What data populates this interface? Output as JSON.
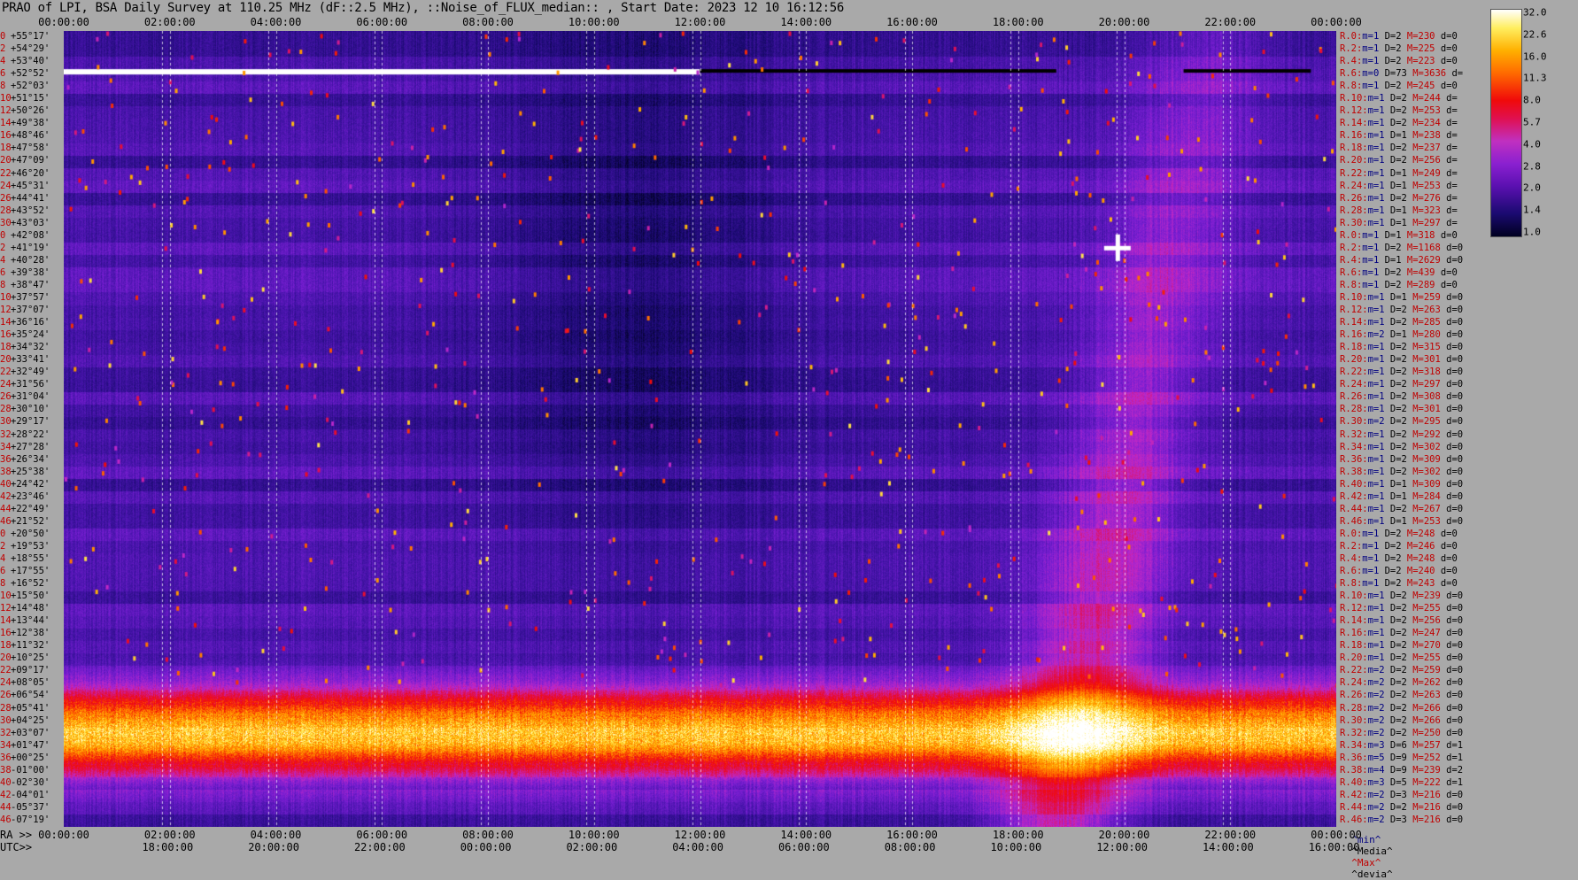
{
  "title": "PRAO of LPI, BSA Daily Survey at 110.25 MHz (dF::2.5 MHz), ::Noise_of_FLUX_median:: , Start Date: 2023 12 10 16:12:56",
  "top_axis": [
    "00:00:00",
    "02:00:00",
    "04:00:00",
    "06:00:00",
    "08:00:00",
    "10:00:00",
    "12:00:00",
    "14:00:00",
    "16:00:00",
    "18:00:00",
    "20:00:00",
    "22:00:00",
    "00:00:00"
  ],
  "ra_axis": {
    "prefix": "RA >>",
    "ticks": [
      "00:00:00",
      "02:00:00",
      "04:00:00",
      "06:00:00",
      "08:00:00",
      "10:00:00",
      "12:00:00",
      "14:00:00",
      "16:00:00",
      "18:00:00",
      "20:00:00",
      "22:00:00",
      "00:00:00"
    ]
  },
  "utc_axis": {
    "prefix": "UTC>>",
    "ticks": [
      "18:00:00",
      "20:00:00",
      "22:00:00",
      "00:00:00",
      "02:00:00",
      "04:00:00",
      "06:00:00",
      "08:00:00",
      "10:00:00",
      "12:00:00",
      "14:00:00",
      "16:00:00"
    ]
  },
  "declinations": [
    "+55°17'",
    "+54°29'",
    "+53°40'",
    "+52°52'",
    "+52°03'",
    "+51°15'",
    "+50°26'",
    "+49°38'",
    "+48°46'",
    "+47°58'",
    "+47°09'",
    "+46°20'",
    "+45°31'",
    "+44°41'",
    "+43°52'",
    "+43°03'",
    "+42°08'",
    "+41°19'",
    "+40°28'",
    "+39°38'",
    "+38°47'",
    "+37°57'",
    "+37°07'",
    "+36°16'",
    "+35°24'",
    "+34°32'",
    "+33°41'",
    "+32°49'",
    "+31°56'",
    "+31°04'",
    "+30°10'",
    "+29°17'",
    "+28°22'",
    "+27°28'",
    "+26°34'",
    "+25°38'",
    "+24°42'",
    "+23°46'",
    "+22°49'",
    "+21°52'",
    "+20°50'",
    "+19°53'",
    "+18°55'",
    "+17°55'",
    "+16°52'",
    "+15°50'",
    "+14°48'",
    "+13°44'",
    "+12°38'",
    "+11°32'",
    "+10°25'",
    "+09°17'",
    "+08°05'",
    "+06°54'",
    "+05°41'",
    "+04°25'",
    "+03°07'",
    "+01°47'",
    "+00°25'",
    "-01°00'",
    "-02°30'",
    "-04°01'",
    "-05°37'",
    "-07°19'"
  ],
  "dec_indices": [
    "0",
    "2",
    "4",
    "6",
    "8",
    "10",
    "12",
    "14",
    "16",
    "18",
    "20",
    "22",
    "24",
    "26",
    "28",
    "30",
    "0",
    "2",
    "4",
    "6",
    "8",
    "10",
    "12",
    "14",
    "16",
    "18",
    "20",
    "22",
    "24",
    "26",
    "28",
    "30",
    "32",
    "34",
    "36",
    "38",
    "40",
    "42",
    "44",
    "46",
    "0",
    "2",
    "4",
    "6",
    "8",
    "10",
    "12",
    "14",
    "16",
    "18",
    "20",
    "22",
    "24",
    "26",
    "28",
    "30",
    "32",
    "34",
    "36",
    "38",
    "40",
    "42",
    "44",
    "46"
  ],
  "stats": [
    {
      "r": "R.0:",
      "m": "1",
      "D": "2",
      "M": "230",
      "d": "0"
    },
    {
      "r": "R.2:",
      "m": "1",
      "D": "2",
      "M": "225",
      "d": "0"
    },
    {
      "r": "R.4:",
      "m": "1",
      "D": "2",
      "M": "223",
      "d": "0"
    },
    {
      "r": "R.6:",
      "m": "0",
      "D": "73",
      "M": "3636",
      "d": ""
    },
    {
      "r": "R.8:",
      "m": "1",
      "D": "2",
      "M": "245",
      "d": "0"
    },
    {
      "r": "R.10:",
      "m": "1",
      "D": "2",
      "M": "244",
      "d": ""
    },
    {
      "r": "R.12:",
      "m": "1",
      "D": "2",
      "M": "253",
      "d": ""
    },
    {
      "r": "R.14:",
      "m": "1",
      "D": "2",
      "M": "234",
      "d": ""
    },
    {
      "r": "R.16:",
      "m": "1",
      "D": "1",
      "M": "238",
      "d": ""
    },
    {
      "r": "R.18:",
      "m": "1",
      "D": "2",
      "M": "237",
      "d": ""
    },
    {
      "r": "R.20:",
      "m": "1",
      "D": "2",
      "M": "256",
      "d": ""
    },
    {
      "r": "R.22:",
      "m": "1",
      "D": "1",
      "M": "249",
      "d": ""
    },
    {
      "r": "R.24:",
      "m": "1",
      "D": "1",
      "M": "253",
      "d": ""
    },
    {
      "r": "R.26:",
      "m": "1",
      "D": "2",
      "M": "276",
      "d": ""
    },
    {
      "r": "R.28:",
      "m": "1",
      "D": "1",
      "M": "323",
      "d": ""
    },
    {
      "r": "R.30:",
      "m": "1",
      "D": "1",
      "M": "297",
      "d": ""
    },
    {
      "r": "R.0:",
      "m": "1",
      "D": "1",
      "M": "318",
      "d": "0"
    },
    {
      "r": "R.2:",
      "m": "1",
      "D": "2",
      "M": "1168",
      "d": "0"
    },
    {
      "r": "R.4:",
      "m": "1",
      "D": "1",
      "M": "2629",
      "d": "0"
    },
    {
      "r": "R.6:",
      "m": "1",
      "D": "2",
      "M": "439",
      "d": "0"
    },
    {
      "r": "R.8:",
      "m": "1",
      "D": "2",
      "M": "289",
      "d": "0"
    },
    {
      "r": "R.10:",
      "m": "1",
      "D": "1",
      "M": "259",
      "d": "0"
    },
    {
      "r": "R.12:",
      "m": "1",
      "D": "2",
      "M": "263",
      "d": "0"
    },
    {
      "r": "R.14:",
      "m": "1",
      "D": "2",
      "M": "285",
      "d": "0"
    },
    {
      "r": "R.16:",
      "m": "2",
      "D": "1",
      "M": "280",
      "d": "0"
    },
    {
      "r": "R.18:",
      "m": "1",
      "D": "2",
      "M": "315",
      "d": "0"
    },
    {
      "r": "R.20:",
      "m": "1",
      "D": "2",
      "M": "301",
      "d": "0"
    },
    {
      "r": "R.22:",
      "m": "1",
      "D": "2",
      "M": "318",
      "d": "0"
    },
    {
      "r": "R.24:",
      "m": "1",
      "D": "2",
      "M": "297",
      "d": "0"
    },
    {
      "r": "R.26:",
      "m": "1",
      "D": "2",
      "M": "308",
      "d": "0"
    },
    {
      "r": "R.28:",
      "m": "1",
      "D": "2",
      "M": "301",
      "d": "0"
    },
    {
      "r": "R.30:",
      "m": "2",
      "D": "2",
      "M": "295",
      "d": "0"
    },
    {
      "r": "R.32:",
      "m": "1",
      "D": "2",
      "M": "292",
      "d": "0"
    },
    {
      "r": "R.34:",
      "m": "1",
      "D": "2",
      "M": "302",
      "d": "0"
    },
    {
      "r": "R.36:",
      "m": "1",
      "D": "2",
      "M": "309",
      "d": "0"
    },
    {
      "r": "R.38:",
      "m": "1",
      "D": "2",
      "M": "302",
      "d": "0"
    },
    {
      "r": "R.40:",
      "m": "1",
      "D": "1",
      "M": "309",
      "d": "0"
    },
    {
      "r": "R.42:",
      "m": "1",
      "D": "1",
      "M": "284",
      "d": "0"
    },
    {
      "r": "R.44:",
      "m": "1",
      "D": "2",
      "M": "267",
      "d": "0"
    },
    {
      "r": "R.46:",
      "m": "1",
      "D": "1",
      "M": "253",
      "d": "0"
    },
    {
      "r": "R.0:",
      "m": "1",
      "D": "2",
      "M": "248",
      "d": "0"
    },
    {
      "r": "R.2:",
      "m": "1",
      "D": "2",
      "M": "246",
      "d": "0"
    },
    {
      "r": "R.4:",
      "m": "1",
      "D": "2",
      "M": "248",
      "d": "0"
    },
    {
      "r": "R.6:",
      "m": "1",
      "D": "2",
      "M": "240",
      "d": "0"
    },
    {
      "r": "R.8:",
      "m": "1",
      "D": "2",
      "M": "243",
      "d": "0"
    },
    {
      "r": "R.10:",
      "m": "1",
      "D": "2",
      "M": "239",
      "d": "0"
    },
    {
      "r": "R.12:",
      "m": "1",
      "D": "2",
      "M": "255",
      "d": "0"
    },
    {
      "r": "R.14:",
      "m": "1",
      "D": "2",
      "M": "256",
      "d": "0"
    },
    {
      "r": "R.16:",
      "m": "1",
      "D": "2",
      "M": "247",
      "d": "0"
    },
    {
      "r": "R.18:",
      "m": "1",
      "D": "2",
      "M": "270",
      "d": "0"
    },
    {
      "r": "R.20:",
      "m": "1",
      "D": "2",
      "M": "255",
      "d": "0"
    },
    {
      "r": "R.22:",
      "m": "2",
      "D": "2",
      "M": "259",
      "d": "0"
    },
    {
      "r": "R.24:",
      "m": "2",
      "D": "2",
      "M": "262",
      "d": "0"
    },
    {
      "r": "R.26:",
      "m": "2",
      "D": "2",
      "M": "263",
      "d": "0"
    },
    {
      "r": "R.28:",
      "m": "2",
      "D": "2",
      "M": "266",
      "d": "0"
    },
    {
      "r": "R.30:",
      "m": "2",
      "D": "2",
      "M": "266",
      "d": "0"
    },
    {
      "r": "R.32:",
      "m": "2",
      "D": "2",
      "M": "250",
      "d": "0"
    },
    {
      "r": "R.34:",
      "m": "3",
      "D": "6",
      "M": "257",
      "d": "1"
    },
    {
      "r": "R.36:",
      "m": "5",
      "D": "9",
      "M": "252",
      "d": "1"
    },
    {
      "r": "R.38:",
      "m": "4",
      "D": "9",
      "M": "239",
      "d": "2"
    },
    {
      "r": "R.40:",
      "m": "3",
      "D": "5",
      "M": "222",
      "d": "1"
    },
    {
      "r": "R.42:",
      "m": "2",
      "D": "3",
      "M": "216",
      "d": "0"
    },
    {
      "r": "R.44:",
      "m": "2",
      "D": "2",
      "M": "216",
      "d": "0"
    },
    {
      "r": "R.46:",
      "m": "2",
      "D": "3",
      "M": "216",
      "d": "0"
    }
  ],
  "stat_legend": {
    "min": "^min^",
    "median": "^Media^",
    "max": "^Max^",
    "dev": "^devia^"
  },
  "colorbar": {
    "labels": [
      "32.0",
      "22.6",
      "16.0",
      "11.3",
      "8.0",
      "5.7",
      "4.0",
      "2.8",
      "2.0",
      "1.4",
      "1.0"
    ]
  },
  "colors": {
    "background": "#a9a9a9",
    "accent": "#c00000",
    "low": "#1a0a50",
    "high": "#ffffff"
  },
  "chart_data": {
    "type": "heatmap",
    "title": "PRAO of LPI, BSA Daily Survey at 110.25 MHz (dF::2.5 MHz), ::Noise_of_FLUX_median:: , Start Date: 2023 12 10 16:12:56",
    "xlabel": "RA >>",
    "x2label": "UTC>>",
    "ylabel": "",
    "xlim": [
      "00:00:00",
      "00:00:00"
    ],
    "colorscale": {
      "min": 1.0,
      "max": 32.0,
      "scale": "log2"
    },
    "features": [
      {
        "name": "bright band",
        "dec": [
          "+01°47'",
          "-07°19'"
        ],
        "ra": [
          "00:00:00",
          "24:00:00"
        ],
        "level": "8.0-32.0"
      },
      {
        "name": "saturated line",
        "dec": "+52°52'",
        "ra": [
          "00:00:00",
          "12:00:00"
        ],
        "level": "32.0"
      },
      {
        "name": "galactic ridge",
        "ra": [
          "18:00:00",
          "21:00:00"
        ],
        "level": "4.0-8.0"
      },
      {
        "name": "point source",
        "ra": "20:00:00",
        "dec": "+41°19'",
        "level": "32.0"
      }
    ]
  }
}
